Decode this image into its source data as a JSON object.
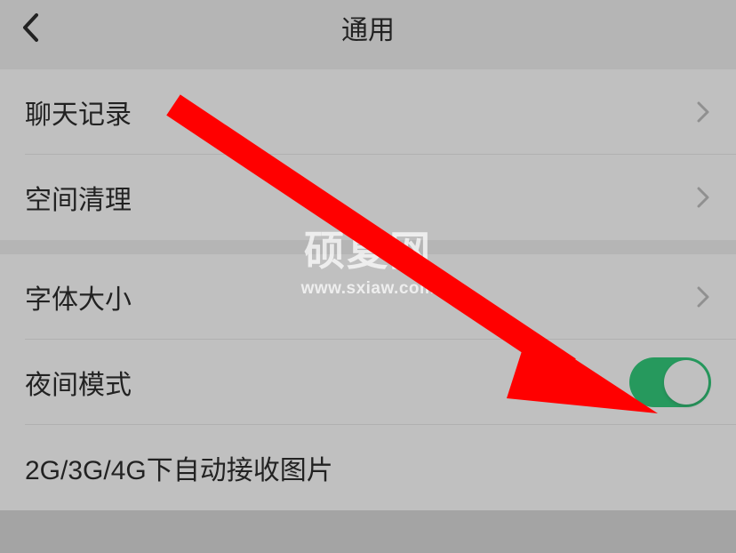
{
  "header": {
    "title": "通用"
  },
  "groups": {
    "group1": {
      "chat_history": "聊天记录",
      "storage_cleanup": "空间清理"
    },
    "group2": {
      "font_size": "字体大小",
      "night_mode": "夜间模式",
      "auto_receive_images": "2G/3G/4G下自动接收图片"
    }
  },
  "states": {
    "night_mode_on": true
  },
  "watermark": {
    "main": "硕夏网",
    "sub": "www.sxiaw.com"
  },
  "annotation": {
    "arrow_color": "#ff0000"
  }
}
